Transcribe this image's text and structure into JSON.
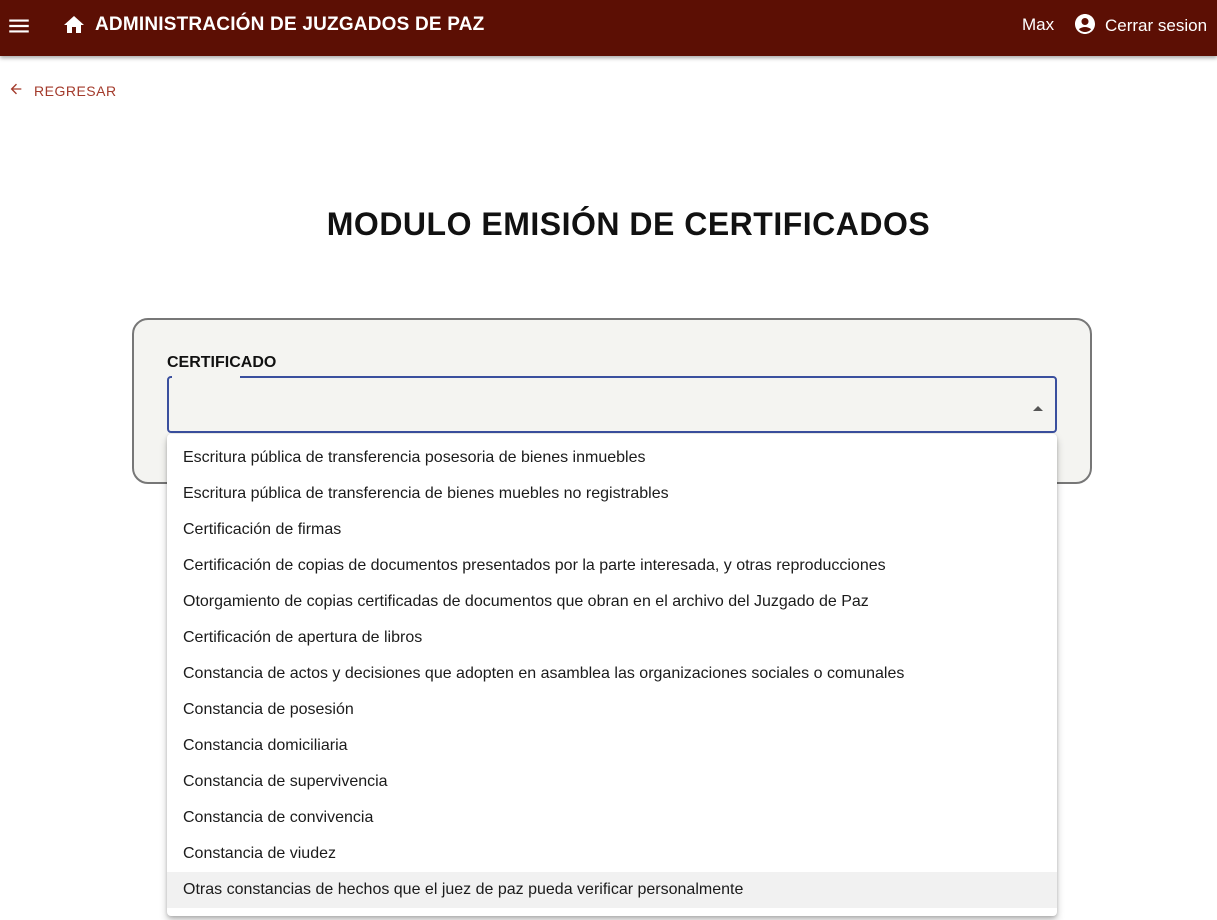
{
  "header": {
    "title": "ADMINISTRACIÓN DE JUZGADOS DE PAZ",
    "user": "Max",
    "logout_label": "Cerrar sesion",
    "background_color": "#5c0f04"
  },
  "back_link": {
    "label": "REGRESAR"
  },
  "page": {
    "title": "MODULO EMISIÓN DE CERTIFICADOS"
  },
  "form": {
    "certificate_label": "CERTIFICADO",
    "selected_value": ""
  },
  "dropdown": {
    "options": [
      "Escritura pública de transferencia posesoria de bienes inmuebles",
      "Escritura pública de transferencia de bienes muebles no registrables",
      "Certificación de firmas",
      "Certificación de copias de documentos presentados por la parte interesada, y otras reproducciones",
      "Otorgamiento de copias certificadas de documentos que obran en el archivo del Juzgado de Paz",
      "Certificación de apertura de libros",
      "Constancia de actos y decisiones que adopten en asamblea las organizaciones sociales o comunales",
      "Constancia de posesión",
      "Constancia domiciliaria",
      "Constancia de supervivencia",
      "Constancia de convivencia",
      "Constancia de viudez",
      "Otras constancias de hechos que el juez de paz pueda verificar personalmente"
    ],
    "hovered_index": 12
  },
  "icons": {
    "menu": "menu-icon",
    "home": "home-icon",
    "account": "account-circle-icon",
    "back": "arrow-back-icon",
    "caret": "caret-up-icon"
  }
}
